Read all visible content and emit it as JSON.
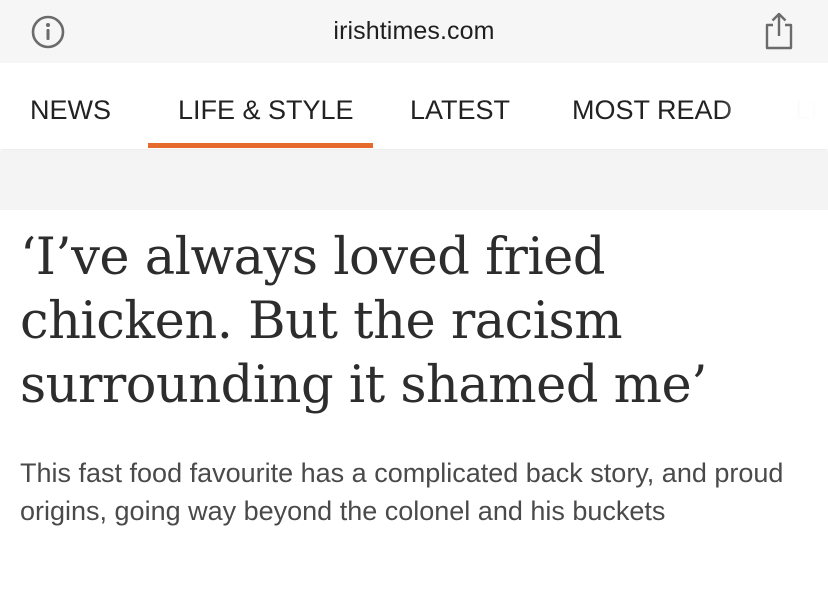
{
  "browser": {
    "url": "irishtimes.com",
    "info_icon": "info-icon",
    "share_icon": "share-icon"
  },
  "nav": {
    "items": [
      {
        "label": "NEWS"
      },
      {
        "label": "LIFE & STYLE",
        "active": true
      },
      {
        "label": "LATEST"
      },
      {
        "label": "MOST READ"
      },
      {
        "label": "LI"
      }
    ],
    "accent_color": "#e66a2c"
  },
  "article": {
    "headline": "‘I’ve always loved fried chicken. But the racism surrounding it shamed me’",
    "standfirst": "This fast food favourite has a complicated back story, and proud origins, going way beyond the colonel and his buckets"
  }
}
